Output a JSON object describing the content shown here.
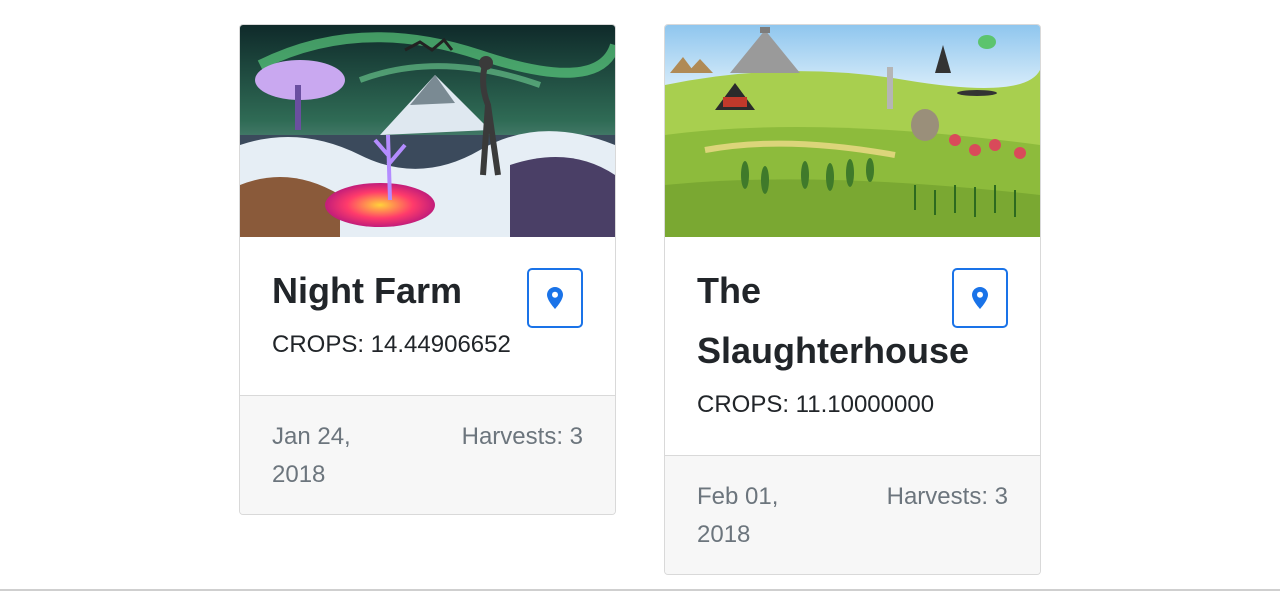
{
  "cards": [
    {
      "title": "Night Farm",
      "crops": "CROPS: 14.44906652",
      "date": "Jan 24, 2018",
      "harvests": "Harvests: 3",
      "location_icon": "map-pin-icon"
    },
    {
      "title": "The Slaughterhouse",
      "crops": "CROPS: 11.10000000",
      "date": "Feb 01, 2018",
      "harvests": "Harvests: 3",
      "location_icon": "map-pin-icon"
    }
  ],
  "colors": {
    "accent": "#1a73e8",
    "muted_text": "#6c757d",
    "footer_bg": "#f7f7f7"
  }
}
